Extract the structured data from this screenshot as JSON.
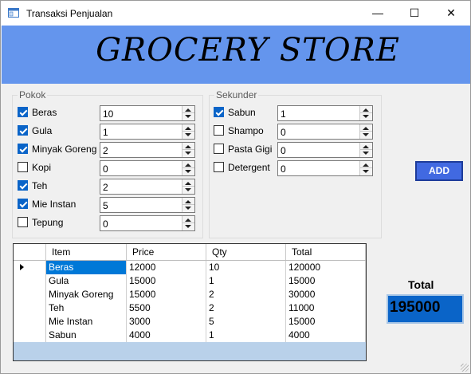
{
  "window": {
    "title": "Transaksi Penjualan",
    "minimize_icon": "minimize-icon",
    "maximize_icon": "maximize-icon",
    "close_icon": "close-icon",
    "min_glyph": "—",
    "max_glyph": "☐",
    "close_glyph": "✕"
  },
  "banner": {
    "title": "GROCERY STORE",
    "color": "#6495ed"
  },
  "pokok": {
    "title": "Pokok",
    "items": [
      {
        "label": "Beras",
        "checked": true,
        "qty": "10"
      },
      {
        "label": "Gula",
        "checked": true,
        "qty": "1"
      },
      {
        "label": "Minyak Goreng",
        "checked": true,
        "qty": "2"
      },
      {
        "label": "Kopi",
        "checked": false,
        "qty": "0"
      },
      {
        "label": "Teh",
        "checked": true,
        "qty": "2"
      },
      {
        "label": "Mie Instan",
        "checked": true,
        "qty": "5"
      },
      {
        "label": "Tepung",
        "checked": false,
        "qty": "0"
      }
    ]
  },
  "sekunder": {
    "title": "Sekunder",
    "items": [
      {
        "label": "Sabun",
        "checked": true,
        "qty": "1"
      },
      {
        "label": "Shampo",
        "checked": false,
        "qty": "0"
      },
      {
        "label": "Pasta Gigi",
        "checked": false,
        "qty": "0"
      },
      {
        "label": "Detergent",
        "checked": false,
        "qty": "0"
      }
    ]
  },
  "add_button": {
    "label": "ADD",
    "color": "#4169e1"
  },
  "table": {
    "columns": [
      "Item",
      "Price",
      "Qty",
      "Total"
    ],
    "rows": [
      [
        "Beras",
        "12000",
        "10",
        "120000"
      ],
      [
        "Gula",
        "15000",
        "1",
        "15000"
      ],
      [
        "Minyak Goreng",
        "15000",
        "2",
        "30000"
      ],
      [
        "Teh",
        "5500",
        "2",
        "11000"
      ],
      [
        "Mie Instan",
        "3000",
        "5",
        "15000"
      ],
      [
        "Sabun",
        "4000",
        "1",
        "4000"
      ]
    ],
    "selected_row": 0
  },
  "total": {
    "label": "Total",
    "value": "195000",
    "color": "#0a64c8"
  }
}
